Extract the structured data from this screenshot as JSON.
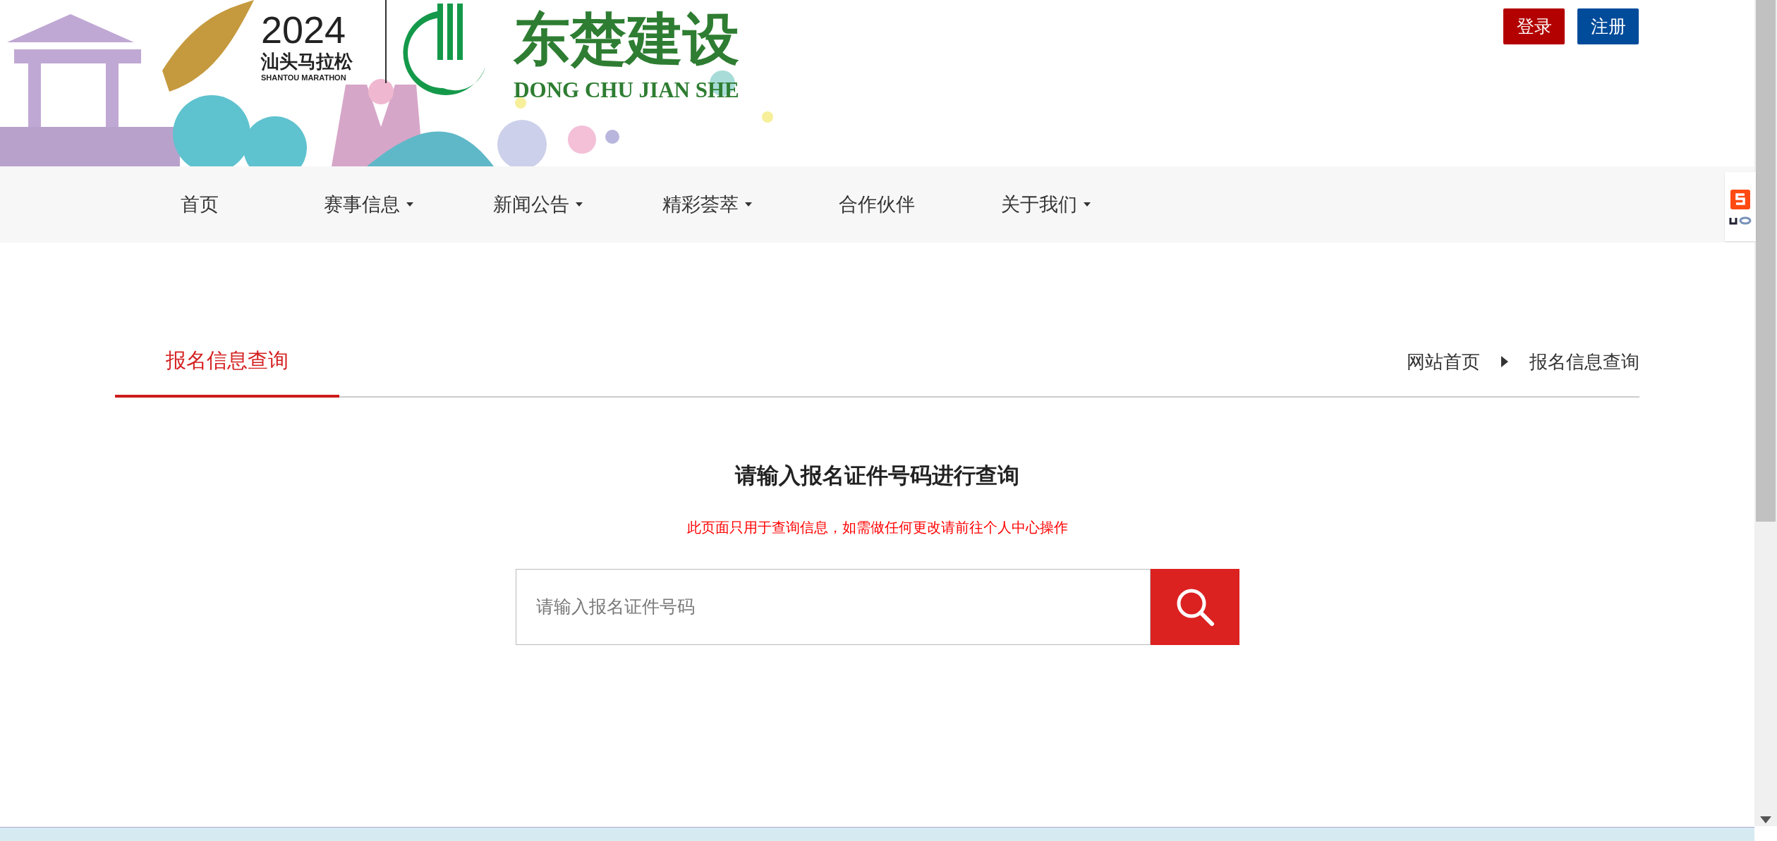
{
  "header": {
    "marathon": {
      "year": "2024",
      "name": "汕头马拉松",
      "name_en": "SHANTOU MARATHON"
    },
    "brand": {
      "name": "东楚建设",
      "name_en": "DONG CHU JIAN SHE"
    },
    "buttons": [
      {
        "label": "登录",
        "kind": "login"
      },
      {
        "label": "注册",
        "kind": "register"
      }
    ]
  },
  "nav": [
    {
      "label": "首页",
      "dropdown": false
    },
    {
      "label": "赛事信息",
      "dropdown": true
    },
    {
      "label": "新闻公告",
      "dropdown": true
    },
    {
      "label": "精彩荟萃",
      "dropdown": true
    },
    {
      "label": "合作伙伴",
      "dropdown": false
    },
    {
      "label": "关于我们",
      "dropdown": true
    }
  ],
  "section": {
    "tab": {
      "label": "报名信息查询",
      "selected": true
    },
    "breadcrumb": [
      "网站首页",
      "报名信息查询"
    ]
  },
  "query": {
    "heading": "请输入报名证件号码进行查询",
    "notice": "此页面只用于查询信息，如需做任何更改请前往个人中心操作",
    "search": {
      "placeholder": "请输入报名证件号码"
    }
  }
}
